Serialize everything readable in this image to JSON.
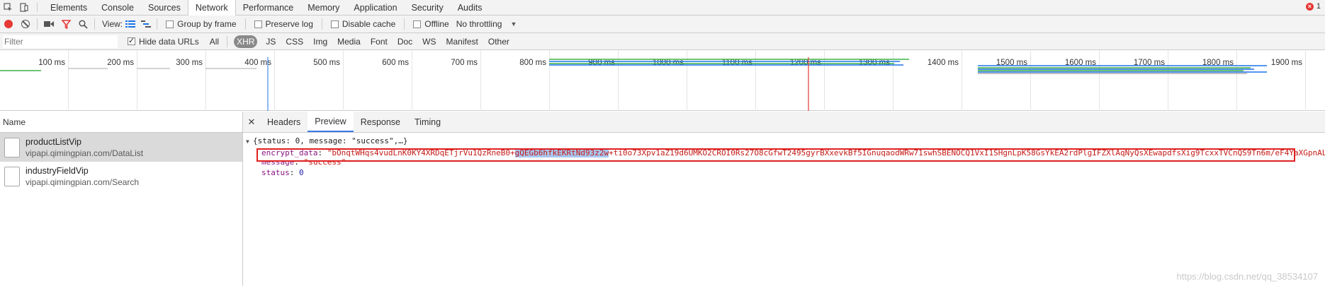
{
  "tabs": [
    "Elements",
    "Console",
    "Sources",
    "Network",
    "Performance",
    "Memory",
    "Application",
    "Security",
    "Audits"
  ],
  "active_tab": "Network",
  "error_count": "1",
  "toolbar": {
    "view_label": "View:",
    "group_by_frame": "Group by frame",
    "preserve_log": "Preserve log",
    "disable_cache": "Disable cache",
    "offline": "Offline",
    "throttling": "No throttling"
  },
  "filter": {
    "placeholder": "Filter",
    "hide_data_urls": "Hide data URLs",
    "types": [
      "All",
      "XHR",
      "JS",
      "CSS",
      "Img",
      "Media",
      "Font",
      "Doc",
      "WS",
      "Manifest",
      "Other"
    ],
    "active_type": "XHR"
  },
  "timeline": {
    "ticks": [
      "100 ms",
      "200 ms",
      "300 ms",
      "400 ms",
      "500 ms",
      "600 ms",
      "700 ms",
      "800 ms",
      "900 ms",
      "1000 ms",
      "1100 ms",
      "1200 ms",
      "1300 ms",
      "1400 ms",
      "1500 ms",
      "1600 ms",
      "1700 ms",
      "1800 ms",
      "1900 ms"
    ]
  },
  "requests_panel": {
    "header": "Name",
    "requests": [
      {
        "name": "productListVip",
        "url": "vipapi.qimingpian.com/DataList"
      },
      {
        "name": "industryFieldVip",
        "url": "vipapi.qimingpian.com/Search"
      }
    ]
  },
  "detail_tabs": [
    "Headers",
    "Preview",
    "Response",
    "Timing"
  ],
  "active_detail_tab": "Preview",
  "preview": {
    "summary": "{status: 0, message: \"success\",…}",
    "encrypt_key": "encrypt_data",
    "encrypt_value_a": "\"bOnqtWHqs4vudLnK0KY4XRDqETjrVu1QzRneB0+",
    "encrypt_value_hl": "gQEGb6hfkEKRtNd93z2w",
    "encrypt_value_b": "+ti0o73Xpv1aZ19d6UMKO2CROI0Rs27O8cGfwT2495gyrBXxevkBf5IGnuqaodWRw71swhSBENOCQ1VxI1SHgnLpK58GsYkEA2rdPlgIFZXlAqNyQsXEwapdfsXig9TcxxTVCnQS9Tn6m/eF4YaXGpnAL",
    "message_key": "message",
    "message_value": "\"success\"",
    "status_key": "status",
    "status_value": "0"
  },
  "watermark": "https://blog.csdn.net/qq_38534107"
}
